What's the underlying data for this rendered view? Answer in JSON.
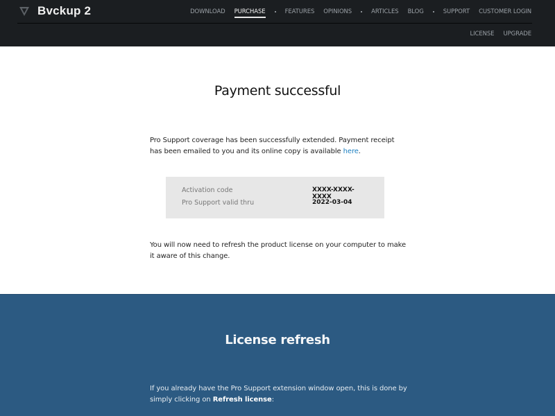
{
  "header": {
    "logo_icon": "bvckup-v-logo-icon",
    "app_name": "Bvckup 2",
    "nav": [
      {
        "label": "DOWNLOAD",
        "active": false
      },
      {
        "label": "PURCHASE",
        "active": true
      },
      {
        "label": "FEATURES",
        "active": false
      },
      {
        "label": "OPINIONS",
        "active": false
      },
      {
        "label": "ARTICLES",
        "active": false
      },
      {
        "label": "BLOG",
        "active": false
      },
      {
        "label": "SUPPORT",
        "active": false
      },
      {
        "label": "CUSTOMER LOGIN",
        "active": false
      }
    ],
    "subnav": [
      {
        "label": "LICENSE"
      },
      {
        "label": "UPGRADE"
      }
    ]
  },
  "main": {
    "title": "Payment successful",
    "para1_text": "Pro Support coverage has been successfully extended. Payment receipt has been emailed to you and its online copy is available ",
    "para1_link": "here",
    "para1_end": ".",
    "info": {
      "activation_label": "Activation code",
      "activation_value": "XXXX-XXXX-XXXX",
      "valid_label": "Pro Support valid thru",
      "valid_value": "2022-03-04"
    },
    "para2": "You will now need to refresh the product license on your computer to make it aware of this change."
  },
  "refresh": {
    "title": "License refresh",
    "para_text": "If you already have the Pro Support extension window open, this is done by simply clicking on ",
    "para_bold": "Refresh license",
    "para_end": ":"
  },
  "colors": {
    "header_bg": "#1b1e21",
    "link": "#1c7fc0",
    "section_blue": "#2c5a82",
    "infobox_bg": "#e7e7e7"
  }
}
